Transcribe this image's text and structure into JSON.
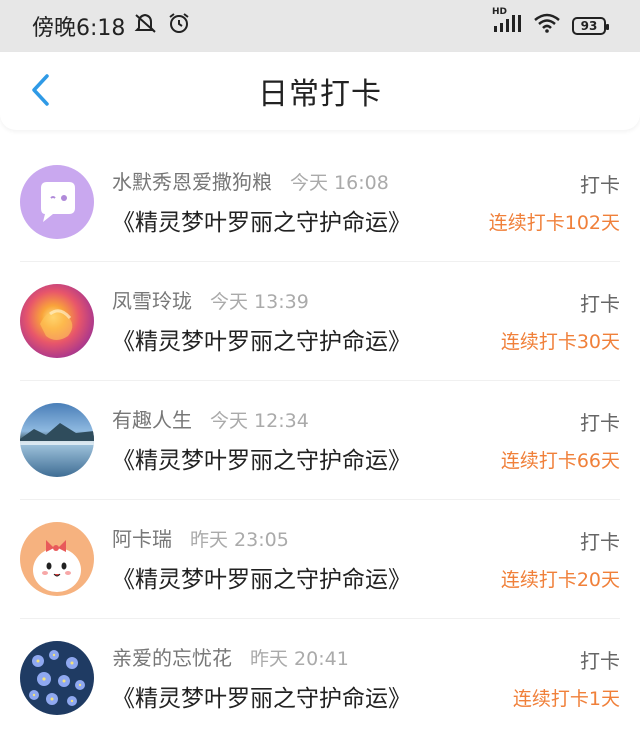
{
  "status_bar": {
    "time": "傍晚6:18",
    "hd_label": "HD",
    "battery": "93"
  },
  "header": {
    "title": "日常打卡"
  },
  "colors": {
    "accent_back": "#2f9ae6",
    "streak": "#f0803a"
  },
  "entries": [
    {
      "username": "水默秀恩爱撒狗粮",
      "time": "今天 16:08",
      "book": "《精灵梦叶罗丽之守护命运》",
      "action": "打卡",
      "streak": "连续打卡102天",
      "avatar_icon": "chat-bubble-avatar"
    },
    {
      "username": "凤雪玲珑",
      "time": "今天 13:39",
      "book": "《精灵梦叶罗丽之守护命运》",
      "action": "打卡",
      "streak": "连续打卡30天",
      "avatar_icon": "flower-avatar"
    },
    {
      "username": "有趣人生",
      "time": "今天 12:34",
      "book": "《精灵梦叶罗丽之守护命运》",
      "action": "打卡",
      "streak": "连续打卡66天",
      "avatar_icon": "lake-landscape-avatar"
    },
    {
      "username": "阿卡瑞",
      "time": "昨天 23:05",
      "book": "《精灵梦叶罗丽之守护命运》",
      "action": "打卡",
      "streak": "连续打卡20天",
      "avatar_icon": "cartoon-girl-avatar"
    },
    {
      "username": "亲爱的忘忧花",
      "time": "昨天 20:41",
      "book": "《精灵梦叶罗丽之守护命运》",
      "action": "打卡",
      "streak": "连续打卡1天",
      "avatar_icon": "blue-flowers-avatar"
    }
  ]
}
